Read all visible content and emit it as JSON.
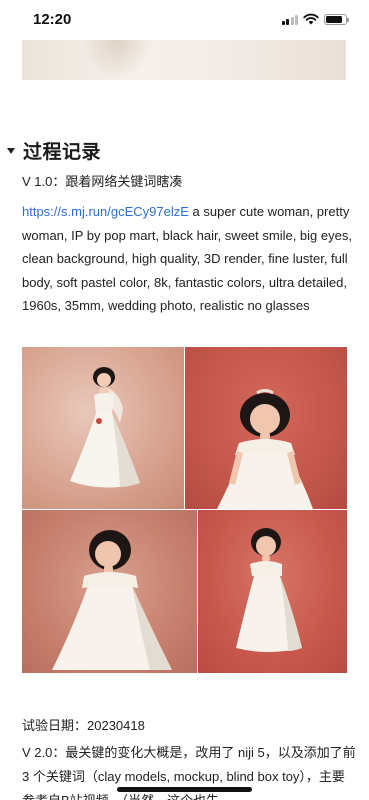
{
  "status_bar": {
    "time": "12:20",
    "signal_icon": "cellular-signal-icon",
    "wifi_icon": "wifi-icon",
    "battery_icon": "battery-icon"
  },
  "section": {
    "heading": "过程记录",
    "collapse_icon": "caret-down-icon"
  },
  "v1": {
    "label": "V 1.0：跟着网络关键词瞎凑",
    "link_text": "https://s.mj.run/gcECy97elzE",
    "prompt_text": " a super cute woman, pretty woman, IP by pop mart, black hair, sweet smile, big eyes, clean background, high quality, 3D render, fine luster, full body, soft pastel color, 8k, fantastic colors, ultra detailed, 1960s, 35mm, wedding photo, realistic no glasses"
  },
  "image_grid": {
    "tiles": [
      "bride-figure-pink-background",
      "bride-figure-red-background",
      "bride-figure-clay-background",
      "bride-figure-coral-background"
    ]
  },
  "date_line": "试验日期：20230418",
  "v2": {
    "text": "V 2.0：最关键的变化大概是，改用了 niji 5，以及添加了前 3 个关键词（clay models, mockup, blind box toy），主要参考自B站视频，（当然，这个也失"
  },
  "colors": {
    "link": "#2f6fd3",
    "text": "#222222"
  }
}
